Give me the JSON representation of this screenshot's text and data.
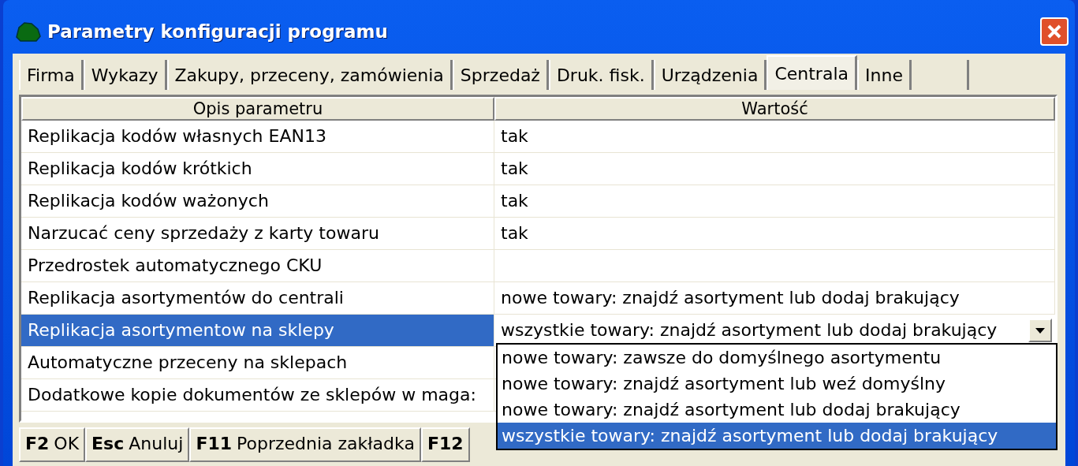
{
  "window": {
    "title": "Parametry konfiguracji programu"
  },
  "tabs": [
    {
      "label": "Firma",
      "selected": false
    },
    {
      "label": "Wykazy",
      "selected": false
    },
    {
      "label": "Zakupy, przeceny, zamówienia",
      "selected": false
    },
    {
      "label": "Sprzedaż",
      "selected": false
    },
    {
      "label": "Druk. fisk.",
      "selected": false
    },
    {
      "label": "Urządzenia",
      "selected": false
    },
    {
      "label": "Centrala",
      "selected": true
    },
    {
      "label": "Inne",
      "selected": false
    }
  ],
  "table": {
    "columns": [
      "Opis parametru",
      "Wartość"
    ],
    "rows": [
      {
        "description": "Replikacja kodów własnych EAN13",
        "value": "tak",
        "selected": false
      },
      {
        "description": "Replikacja kodów krótkich",
        "value": "tak",
        "selected": false
      },
      {
        "description": "Replikacja kodów ważonych",
        "value": "tak",
        "selected": false
      },
      {
        "description": "Narzucać ceny sprzedaży z karty towaru",
        "value": "tak",
        "selected": false
      },
      {
        "description": "Przedrostek automatycznego CKU",
        "selected": false
      },
      {
        "description": "Replikacja asortymentów do centrali",
        "value": "nowe towary: znajdź asortyment lub dodaj brakujący",
        "selected": false
      },
      {
        "description": "Replikacja asortymentow na sklepy",
        "value": "wszystkie towary: znajdź asortyment lub dodaj brakujący",
        "selected": true
      },
      {
        "description": "Automatyczne przeceny na sklepach",
        "selected": false
      },
      {
        "description": "Dodatkowe kopie dokumentów ze sklepów w maga:",
        "selected": false
      }
    ]
  },
  "dropdown": {
    "options": [
      {
        "label": "nowe towary: zawsze do domyślnego asortymentu",
        "selected": false
      },
      {
        "label": "nowe towary: znajdź asortyment lub weź domyślny",
        "selected": false
      },
      {
        "label": "nowe towary: znajdź asortyment lub dodaj brakujący",
        "selected": false
      },
      {
        "label": "wszystkie towary: znajdź asortyment lub dodaj brakujący",
        "selected": true
      }
    ]
  },
  "status_bar": [
    {
      "key": "F2",
      "label": "OK"
    },
    {
      "key": "Esc",
      "label": "Anuluj"
    },
    {
      "key": "F11",
      "label": "Poprzednia zakładka"
    },
    {
      "key": "F12"
    }
  ]
}
